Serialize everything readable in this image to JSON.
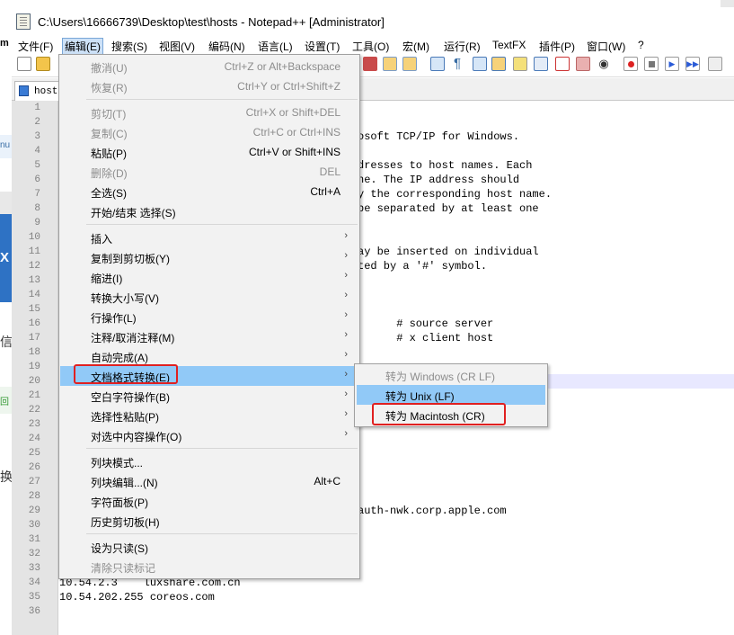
{
  "window": {
    "title": "C:\\Users\\16666739\\Desktop\\test\\hosts - Notepad++ [Administrator]"
  },
  "menubar": {
    "items": [
      "文件(F)",
      "编辑(E)",
      "搜索(S)",
      "视图(V)",
      "编码(N)",
      "语言(L)",
      "设置(T)",
      "工具(O)",
      "宏(M)",
      "运行(R)",
      "TextFX",
      "插件(P)",
      "窗口(W)",
      "?"
    ]
  },
  "tabs": {
    "active": "hosts"
  },
  "left_strip": {
    "fragments": [
      "m",
      "nu",
      "X",
      "信",
      "回",
      "换"
    ]
  },
  "editor": {
    "line_numbers": [
      "1",
      "2",
      "3",
      "4",
      "5",
      "6",
      "7",
      "8",
      "9",
      "10",
      "11",
      "12",
      "13",
      "14",
      "15",
      "16",
      "17",
      "18",
      "19",
      "20",
      "21",
      "22",
      "23",
      "24",
      "25",
      "26",
      "27",
      "28",
      "29",
      "30",
      "31",
      "32",
      "33",
      "34",
      "35",
      "36"
    ],
    "visible_text": {
      "l3": "osoft TCP/IP for Windows.",
      "l5": "dresses to host names. Each",
      "l6": "ne. The IP address should",
      "l7": "y the corresponding host name.",
      "l8": "be separated by at least one",
      "l11": "ay be inserted on individual",
      "l12": "ted by a '#' symbol.",
      "l16": "      # source server",
      "l17": "      # x client host",
      "l28": "auth-nwk.corp.apple.com",
      "l34": "10.54.2.3    luxshare.com.cn",
      "l35": "10.54.202.255 coreos.com"
    }
  },
  "edit_menu": {
    "undo": {
      "label": "撤消(U)",
      "shortcut": "Ctrl+Z or Alt+Backspace"
    },
    "redo": {
      "label": "恢复(R)",
      "shortcut": "Ctrl+Y or Ctrl+Shift+Z"
    },
    "cut": {
      "label": "剪切(T)",
      "shortcut": "Ctrl+X or Shift+DEL"
    },
    "copy": {
      "label": "复制(C)",
      "shortcut": "Ctrl+C or Ctrl+INS"
    },
    "paste": {
      "label": "粘贴(P)",
      "shortcut": "Ctrl+V or Shift+INS"
    },
    "delete": {
      "label": "删除(D)",
      "shortcut": "DEL"
    },
    "select_all": {
      "label": "全选(S)",
      "shortcut": "Ctrl+A"
    },
    "begin_end_select": {
      "label": "开始/结束 选择(S)"
    },
    "insert": {
      "label": "插入"
    },
    "copy_to_clipboard": {
      "label": "复制到剪切板(Y)"
    },
    "indent": {
      "label": "缩进(I)"
    },
    "convert_case": {
      "label": "转换大小写(V)"
    },
    "line_ops": {
      "label": "行操作(L)"
    },
    "comment": {
      "label": "注释/取消注释(M)"
    },
    "autocomplete": {
      "label": "自动完成(A)"
    },
    "eol_conversion": {
      "label": "文档格式转换(E)"
    },
    "blank_ops": {
      "label": "空白字符操作(B)"
    },
    "paste_special": {
      "label": "选择性粘贴(P)"
    },
    "on_selection": {
      "label": "对选中内容操作(O)"
    },
    "column_mode": {
      "label": "列块模式..."
    },
    "column_editor": {
      "label": "列块编辑...(N)",
      "shortcut": "Alt+C"
    },
    "char_panel": {
      "label": "字符面板(P)"
    },
    "clipboard_history": {
      "label": "历史剪切板(H)"
    },
    "set_readonly": {
      "label": "设为只读(S)"
    },
    "clear_readonly": {
      "label": "清除只读标记"
    }
  },
  "eol_submenu": {
    "windows": "转为 Windows (CR LF)",
    "unix": "转为 Unix (LF)",
    "mac": "转为 Macintosh (CR)"
  },
  "colors": {
    "menu_highlight": "#91c9f7",
    "annotation_red": "#e02020",
    "gutter": "#e4e4e4"
  }
}
